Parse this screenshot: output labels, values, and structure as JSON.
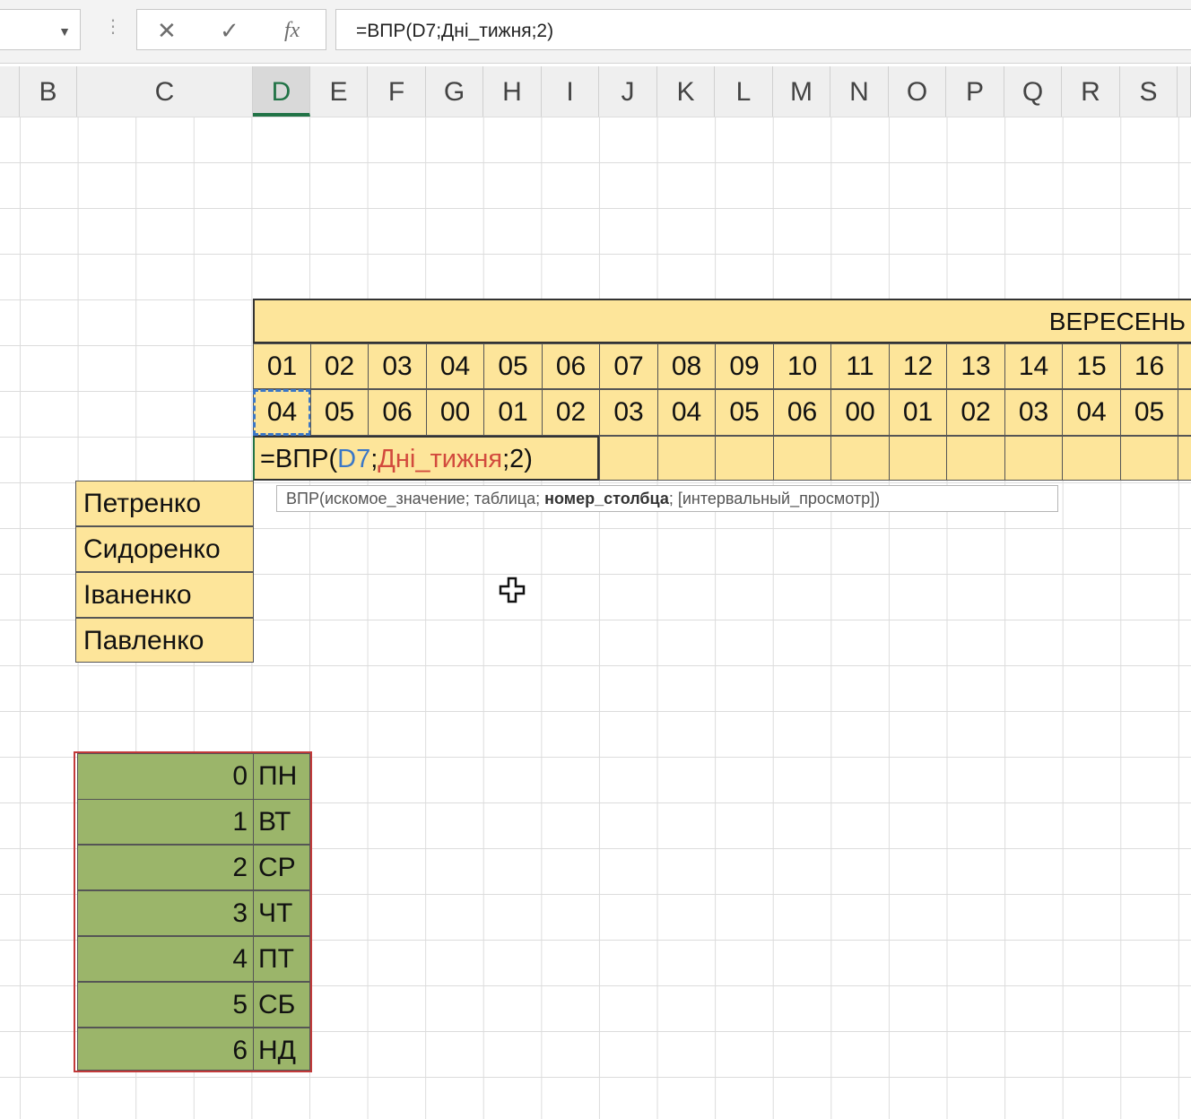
{
  "formula_bar": {
    "name_box": "",
    "cancel_icon": "✕",
    "enter_icon": "✓",
    "fx_icon": "fx",
    "formula": "=ВПР(D7;Дні_тижня;2)"
  },
  "columns": [
    "B",
    "C",
    "D",
    "E",
    "F",
    "G",
    "H",
    "I",
    "J",
    "K",
    "L",
    "M",
    "N",
    "O",
    "P",
    "Q",
    "R",
    "S"
  ],
  "active_column": "D",
  "month_header": "ВЕРЕСЕНЬ",
  "day_numbers": [
    "01",
    "02",
    "03",
    "04",
    "05",
    "06",
    "07",
    "08",
    "09",
    "10",
    "11",
    "12",
    "13",
    "14",
    "15",
    "16"
  ],
  "weekday_codes": [
    "04",
    "05",
    "06",
    "00",
    "01",
    "02",
    "03",
    "04",
    "05",
    "06",
    "00",
    "01",
    "02",
    "03",
    "04",
    "05"
  ],
  "editing_formula": {
    "prefix": "=ВПР(",
    "ref": "D7",
    "sep1": ";",
    "named_range": "Дні_тижня",
    "suffix": ";2)"
  },
  "tooltip": {
    "func": "ВПР(искомое_значение; таблица; ",
    "bold_arg": "номер_столбца",
    "rest": "; [интервальный_просмотр])"
  },
  "employees": [
    "Петренко",
    "Сидоренко",
    "Іваненко",
    "Павленко"
  ],
  "days_lookup": [
    {
      "num": "0",
      "day": "ПН"
    },
    {
      "num": "1",
      "day": "ВТ"
    },
    {
      "num": "2",
      "day": "СР"
    },
    {
      "num": "3",
      "day": "ЧТ"
    },
    {
      "num": "4",
      "day": "ПТ"
    },
    {
      "num": "5",
      "day": "СБ"
    },
    {
      "num": "6",
      "day": "НД"
    }
  ],
  "colors": {
    "yellow_fill": "#fde59a",
    "green_fill": "#9bb56a",
    "accent_green": "#217346",
    "reference_blue": "#3a77c7",
    "named_range_red": "#d24a3d"
  }
}
